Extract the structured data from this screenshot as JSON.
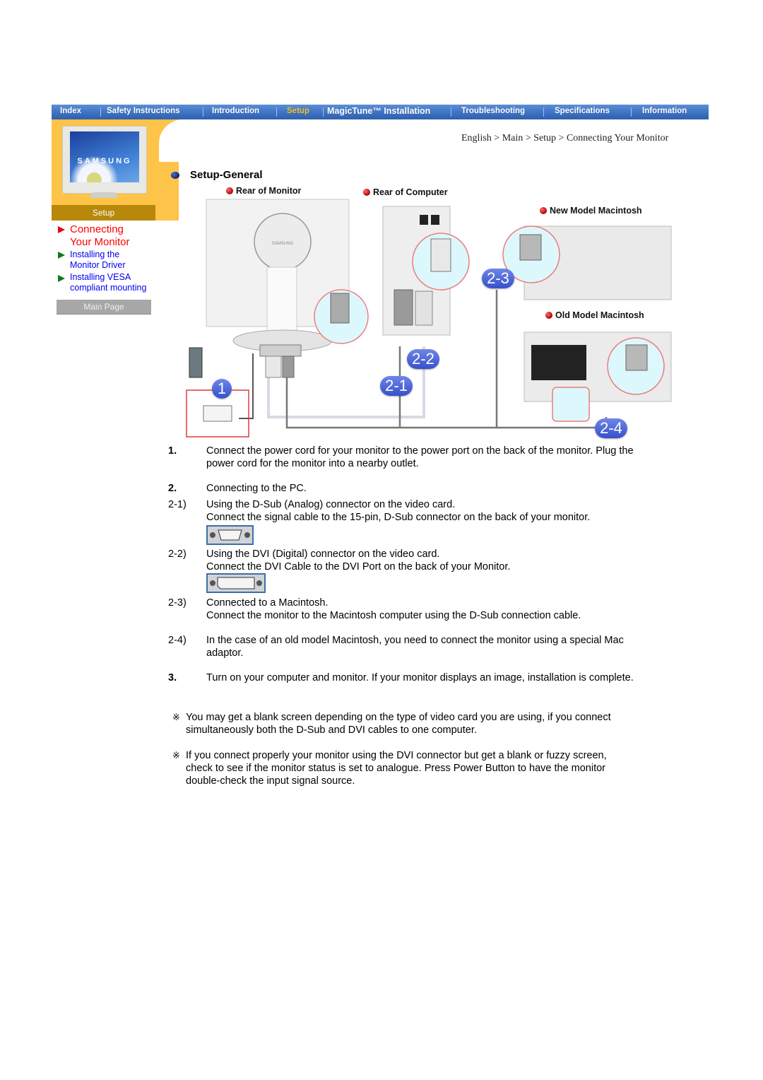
{
  "nav": {
    "items": [
      {
        "label": "Index",
        "active": false
      },
      {
        "label": "Safety Instructions",
        "active": false
      },
      {
        "label": "Introduction",
        "active": false
      },
      {
        "label": "Setup",
        "active": true
      },
      {
        "label": "MagicTune™ Installation",
        "active": false
      },
      {
        "label": "Troubleshooting",
        "active": false
      },
      {
        "label": "Specifications",
        "active": false
      },
      {
        "label": "Information",
        "active": false
      }
    ],
    "active_color": "#f7c431",
    "bar_color": "#3e72c2"
  },
  "sidebar": {
    "monitor_brand": "SAMSUNG",
    "section_label": "Setup",
    "links": [
      {
        "label_line1": "Connecting",
        "label_line2": "Your Monitor",
        "current": true
      },
      {
        "label_line1": "Installing the",
        "label_line2": "Monitor Driver",
        "current": false
      },
      {
        "label_line1": "Installing VESA",
        "label_line2": "compliant mounting",
        "current": false
      }
    ],
    "main_page_label": "Main Page",
    "accent_color": "#fec349"
  },
  "breadcrumb": {
    "items": [
      "English",
      "Main",
      "Setup",
      "Connecting Your Monitor"
    ],
    "separator": ">"
  },
  "section_title": "Setup-General",
  "diagram": {
    "labels": {
      "rear_monitor": "Rear of Monitor",
      "rear_computer": "Rear of Computer",
      "new_mac": "New Model Macintosh",
      "old_mac": "Old Model Macintosh",
      "monitor_brand": "SAMSUNG"
    },
    "badges": [
      "1",
      "2-1",
      "2-2",
      "2-3",
      "2-4"
    ]
  },
  "steps": [
    {
      "num": "1.",
      "bold": true,
      "lines": [
        "Connect the power cord for your monitor to the power port on the back of the monitor. Plug the",
        "power cord for the monitor into a nearby outlet."
      ]
    },
    {
      "num": "2.",
      "bold": true,
      "lines": [
        "Connecting to the PC."
      ]
    },
    {
      "num": "2-1)",
      "bold": false,
      "lines": [
        "Using the D-Sub (Analog) connector on the video card.",
        "Connect the signal cable to the 15-pin, D-Sub connector on the back of your monitor."
      ],
      "connector": "dsub"
    },
    {
      "num": "2-2)",
      "bold": false,
      "lines": [
        "Using the DVI (Digital) connector on the video card.",
        "Connect the DVI Cable to the DVI Port on the back of your Monitor."
      ],
      "connector": "dvi"
    },
    {
      "num": "2-3)",
      "bold": false,
      "lines": [
        "Connected to a Macintosh.",
        "Connect the monitor to the Macintosh computer using the D-Sub connection cable."
      ]
    },
    {
      "num": "2-4)",
      "bold": false,
      "lines": [
        "In the case of an old model Macintosh, you need to connect the monitor using a special Mac",
        "adaptor."
      ]
    },
    {
      "num": "3.",
      "bold": true,
      "lines": [
        "Turn on your computer and monitor. If your monitor displays an image, installation is complete."
      ]
    }
  ],
  "notes": [
    {
      "mark": "※",
      "lines": [
        "You may get a blank screen depending on the type of video card you are using, if you connect",
        "simultaneously both the D-Sub and DVI cables to one computer."
      ]
    },
    {
      "mark": "※",
      "lines": [
        "If you connect properly your monitor using the DVI connector but get a blank or fuzzy screen,",
        "check to see if the monitor status is set to analogue. Press Power Button to have the monitor",
        "double-check the input signal source."
      ]
    }
  ]
}
